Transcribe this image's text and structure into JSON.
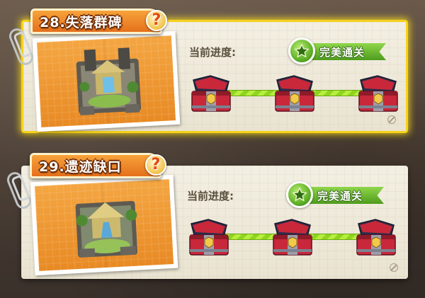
{
  "levels": [
    {
      "id": "28",
      "title": "28.失落群碑",
      "help_icon": "question-mark-icon",
      "help_label": "?",
      "progress_label": "当前进度:",
      "status_label": "完美通关",
      "selected": true,
      "chests_opened": 3,
      "chests_total": 3
    },
    {
      "id": "29",
      "title": "29.遗迹缺口",
      "help_icon": "question-mark-icon",
      "help_label": "?",
      "progress_label": "当前进度:",
      "status_label": "完美通关",
      "selected": false,
      "chests_opened": 3,
      "chests_total": 3
    }
  ],
  "colors": {
    "selected_border": "#f6d21c",
    "title_tab": "#e5701c",
    "badge_green": "#5aac24",
    "track_green": "#b7ee3f",
    "chest_red": "#c8283a"
  }
}
